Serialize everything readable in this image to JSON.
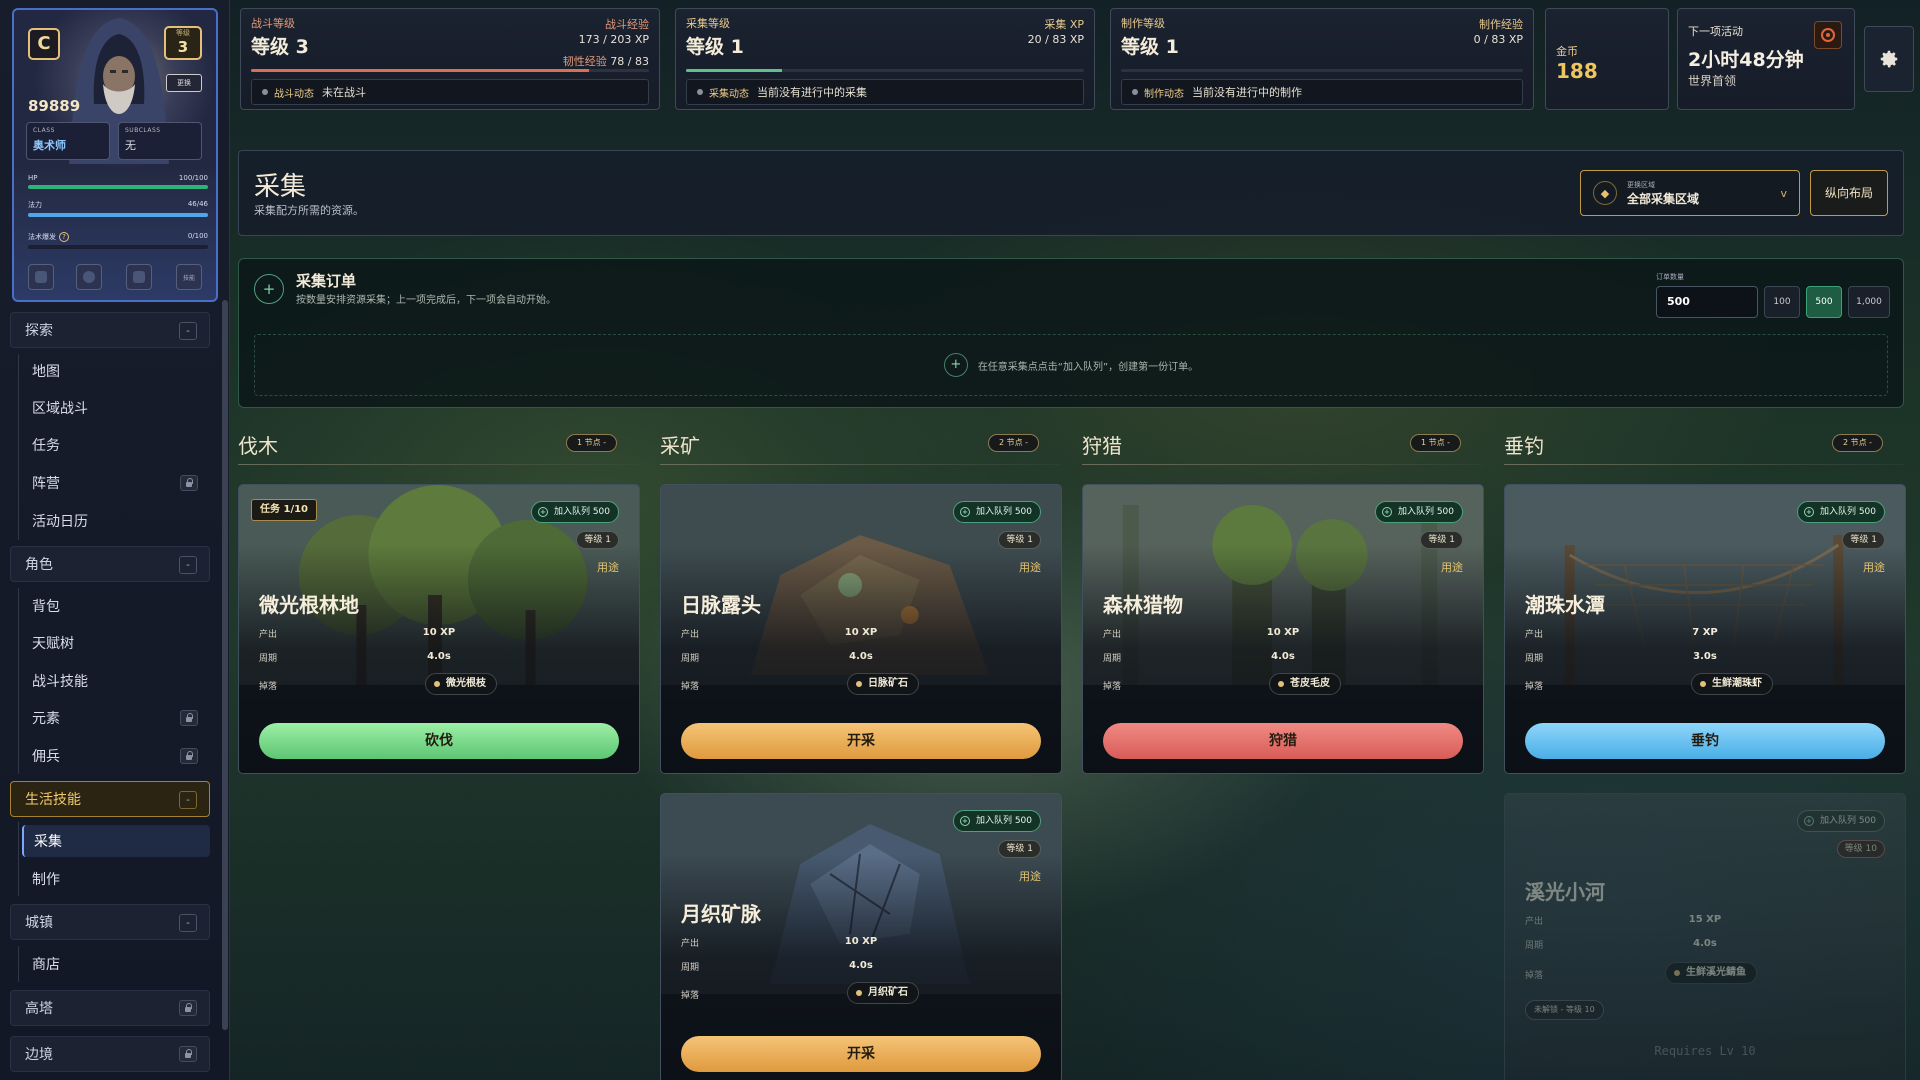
{
  "profile": {
    "rank_letter": "C",
    "level_label": "等级",
    "level": "3",
    "edit_label": "更换",
    "power": "89889",
    "class_key": "CLASS",
    "class_value": "奥术师",
    "subclass_key": "SUBCLASS",
    "subclass_value": "无",
    "hp_label": "HP",
    "hp_text": "100/100",
    "hp_fraction": 1.0,
    "mana_label": "法力",
    "mana_text": "46/46",
    "mana_fraction": 1.0,
    "burst_label": "法术爆发",
    "burst_help": "?",
    "burst_text": "0/100",
    "burst_fraction": 0.0,
    "slot_text": "技能",
    "colors": {
      "hp": "#2fb27a",
      "mana": "#4fa6e8",
      "border": "#4a6fc9"
    }
  },
  "nav": {
    "explore": {
      "label": "探索",
      "toggle": "-",
      "items": [
        "地图",
        "区域战斗",
        "任务",
        "阵营",
        "活动日历"
      ]
    },
    "character": {
      "label": "角色",
      "toggle": "-",
      "items": [
        "背包",
        "天赋树",
        "战斗技能",
        "元素",
        "佣兵"
      ]
    },
    "life": {
      "label": "生活技能",
      "toggle": "-",
      "items": [
        "采集",
        "制作"
      ]
    },
    "town": {
      "label": "城镇",
      "toggle": "-",
      "items": [
        "商店"
      ]
    },
    "highland": {
      "label": "高塔"
    },
    "border": {
      "label": "边境"
    }
  },
  "top": {
    "combat": {
      "label": "战斗等级",
      "level": "等级 3",
      "xp_label": "战斗经验",
      "xp": "173 / 203 XP",
      "toughness_label": "韧性经验",
      "toughness": "78 / 83",
      "progress": 0.85,
      "status_key": "战斗动态",
      "status": "未在战斗"
    },
    "gather": {
      "label": "采集等级",
      "level": "等级 1",
      "xp_label": "采集 XP",
      "xp": "20 / 83 XP",
      "progress": 0.24,
      "status_key": "采集动态",
      "status": "当前没有进行中的采集"
    },
    "craft": {
      "label": "制作等级",
      "level": "等级 1",
      "xp_label": "制作经验",
      "xp": "0 / 83 XP",
      "progress": 0.0,
      "status_key": "制作动态",
      "status": "当前没有进行中的制作"
    },
    "gold": {
      "label": "金币",
      "value": "188"
    },
    "event": {
      "label": "下一项活动",
      "time": "2小时48分钟",
      "name": "世界首领"
    }
  },
  "header": {
    "title": "采集",
    "subtitle": "采集配方所需的资源。",
    "region_key": "更换区域",
    "region_value": "全部采集区域",
    "region_chevron": "v",
    "layout_button": "纵向布局"
  },
  "order": {
    "icon": "+",
    "title": "采集订单",
    "subtitle": "按数量安排资源采集；上一项完成后，下一项会自动开始。",
    "qty_label": "订单数量",
    "qty_value": "500",
    "presets": [
      "100",
      "500",
      "1,000"
    ],
    "empty_icon": "+",
    "empty_text": "在任意采集点点击“加入队列”，创建第一份订单。"
  },
  "columns": [
    {
      "title": "伐木",
      "pill": "1 节点 -"
    },
    {
      "title": "采矿",
      "pill": "2 节点 -"
    },
    {
      "title": "狩猎",
      "pill": "1 节点 -"
    },
    {
      "title": "垂钓",
      "pill": "2 节点 -"
    }
  ],
  "card_labels": {
    "output": "产出",
    "cycle": "周期",
    "drop": "掉落",
    "use": "用途",
    "queue": "加入队列 500",
    "level": "等级 1"
  },
  "cards": {
    "wood": {
      "task": "任务 1/10",
      "name": "微光根林地",
      "xp": "10 XP",
      "cycle": "4.0s",
      "drop": "微光根枝",
      "action": "砍伐"
    },
    "ore1": {
      "name": "日脉露头",
      "xp": "10 XP",
      "cycle": "4.0s",
      "drop": "日脉矿石",
      "action": "开采"
    },
    "hunt": {
      "name": "森林猎物",
      "xp": "10 XP",
      "cycle": "4.0s",
      "drop": "苍皮毛皮",
      "action": "狩猎"
    },
    "fish1": {
      "name": "潮珠水潭",
      "xp": "7 XP",
      "cycle": "3.0s",
      "drop": "生鲜潮珠虾",
      "action": "垂钓"
    },
    "ore2": {
      "name": "月织矿脉",
      "xp": "10 XP",
      "cycle": "4.0s",
      "drop": "月织矿石",
      "action": "开采"
    },
    "fish2": {
      "queue": "加入队列 500",
      "level": "等级 10",
      "name": "溪光小河",
      "xp": "15 XP",
      "cycle": "4.0s",
      "drop": "生鲜溪光鲭鱼",
      "lock_note": "未解锁 - 等级 10",
      "requires": "Requires Lv 10"
    }
  },
  "colors": {
    "chop": "#6fd38a",
    "mine": "#e6a64a",
    "hunt": "#e2625e",
    "fish": "#4fb3ea"
  }
}
